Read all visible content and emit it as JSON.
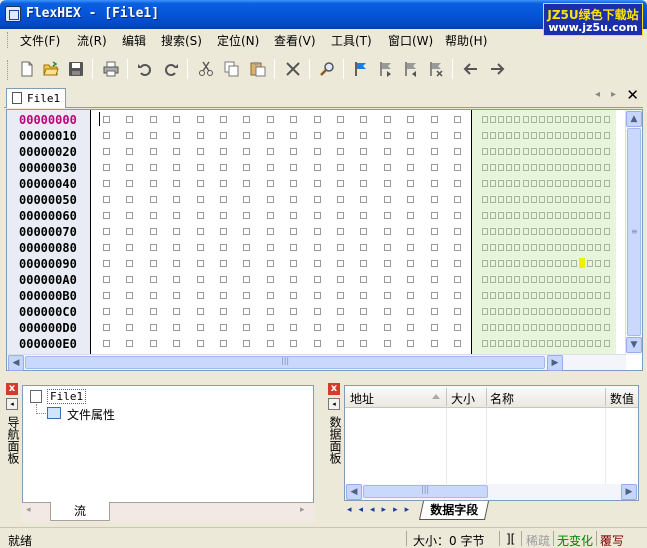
{
  "window": {
    "title": "FlexHEX - [File1]"
  },
  "badge": {
    "line1": "JZ5U绿色下载站",
    "line2": "www.jz5u.com"
  },
  "menu": {
    "items": [
      "文件(F)",
      "流(R)",
      "编辑",
      "搜索(S)",
      "定位(N)",
      "查看(V)",
      "工具(T)",
      "窗口(W)",
      "帮助(H)"
    ]
  },
  "toolbar": {
    "icons": [
      "new-file-icon",
      "open-folder-icon",
      "save-icon",
      "print-icon",
      "undo-icon",
      "redo-icon",
      "cut-icon",
      "copy-icon",
      "paste-icon",
      "delete-icon",
      "find-icon",
      "set-bookmark-icon",
      "next-bookmark-icon",
      "prev-bookmark-icon",
      "clear-bookmark-icon",
      "back-arrow-icon",
      "forward-arrow-icon"
    ]
  },
  "doc_tab": {
    "label": "File1",
    "nav_left": "◂",
    "nav_right": "▸",
    "close": "✕"
  },
  "hex": {
    "addresses": [
      "00000000",
      "00000010",
      "00000020",
      "00000030",
      "00000040",
      "00000050",
      "00000060",
      "00000070",
      "00000080",
      "00000090",
      "000000A0",
      "000000B0",
      "000000C0",
      "000000D0",
      "000000E0"
    ],
    "current_row": 0,
    "bytes_per_row": 16,
    "highlight": {
      "row": 9,
      "col": 12
    },
    "colors": {
      "address_current": "#c0007a",
      "ascii_bg": "#e7f5dc",
      "address_bg": "#e9ecf5",
      "highlight": "#f0f000"
    }
  },
  "nav_panel": {
    "side_label": "导航面板",
    "close": "x",
    "arrow": "◂",
    "tree_root": "File1",
    "tree_child": "文件属性",
    "tab": "流"
  },
  "data_panel": {
    "side_label": "数据面板",
    "close": "x",
    "arrow": "◂",
    "columns": [
      "地址",
      "大小",
      "名称",
      "数值"
    ],
    "tab": "数据字段",
    "nav": "◂◂◂▸▸▸"
  },
  "status": {
    "ready": "就绪",
    "size": "大小：0 字节",
    "caret": "][",
    "mode1": "稀疏",
    "mode2": "无变化",
    "mode3": "覆写",
    "mode2_color": "#008000",
    "mode3_color": "#800000"
  }
}
